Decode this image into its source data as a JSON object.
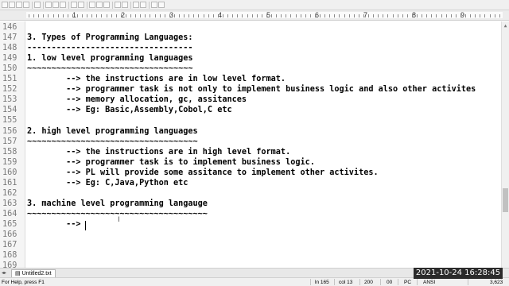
{
  "editor": {
    "lines": [
      {
        "num": "146",
        "text": ""
      },
      {
        "num": "147",
        "text": "3. Types of Programming Languages:"
      },
      {
        "num": "148",
        "text": "----------------------------------"
      },
      {
        "num": "149",
        "text": "1. low level programming languages"
      },
      {
        "num": "150",
        "text": "~~~~~~~~~~~~~~~~~~~~~~~~~~~~~~~~~~"
      },
      {
        "num": "151",
        "text": "        --> the instructions are in low level format."
      },
      {
        "num": "152",
        "text": "        --> programmer task is not only to implement business logic and also other activites"
      },
      {
        "num": "153",
        "text": "        --> memory allocation, gc, assitances"
      },
      {
        "num": "154",
        "text": "        --> Eg: Basic,Assembly,Cobol,C etc"
      },
      {
        "num": "155",
        "text": ""
      },
      {
        "num": "156",
        "text": "2. high level programming languages"
      },
      {
        "num": "157",
        "text": "~~~~~~~~~~~~~~~~~~~~~~~~~~~~~~~~~~~"
      },
      {
        "num": "158",
        "text": "        --> the instructions are in high level format."
      },
      {
        "num": "159",
        "text": "        --> programmer task is to implement business logic."
      },
      {
        "num": "160",
        "text": "        --> PL will provide some assitance to implement other activites."
      },
      {
        "num": "161",
        "text": "        --> Eg: C,Java,Python etc"
      },
      {
        "num": "162",
        "text": ""
      },
      {
        "num": "163",
        "text": "3. machine level programming langauge"
      },
      {
        "num": "164",
        "text": "~~~~~~~~~~~~~~~~~~~~~~~~~~~~~~~~~~~~~"
      },
      {
        "num": "165",
        "text": "        --> "
      },
      {
        "num": "166",
        "text": ""
      },
      {
        "num": "167",
        "text": ""
      },
      {
        "num": "168",
        "text": ""
      },
      {
        "num": "169",
        "text": ""
      }
    ]
  },
  "ruler": {
    "numbers": [
      "1",
      "2",
      "3",
      "4",
      "5",
      "6",
      "7",
      "8",
      "9"
    ]
  },
  "tab": {
    "label": "Untitled2.txt"
  },
  "status": {
    "help": "For Help, press F1",
    "line": "ln 165",
    "col": "col 13",
    "v1": "200",
    "v2": "00",
    "mode": "PC",
    "encoding": "ANSI",
    "size": "3,623"
  },
  "clock": {
    "text": "2021-10-24  16:28:45"
  },
  "colors": {
    "accent": "#2b2b2b"
  }
}
